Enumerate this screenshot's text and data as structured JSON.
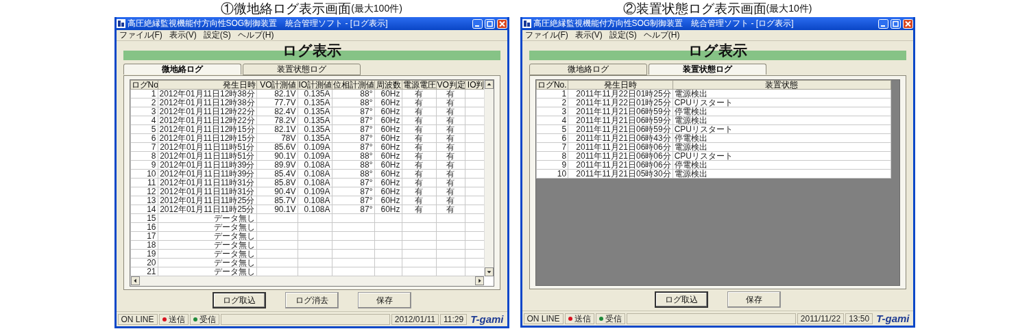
{
  "screens": [
    {
      "caption": "①微地絡ログ表示画面",
      "caption_note": "(最大100件)",
      "window": {
        "title": "高圧絶縁監視機能付方向性SOG制御装置　統合管理ソフト - [ログ表示]",
        "menu": [
          "ファイル(F)",
          "表示(V)",
          "設定(S)",
          "ヘルプ(H)"
        ],
        "heading": "ログ表示",
        "tabs": [
          {
            "label": "微地絡ログ",
            "selected": true
          },
          {
            "label": "装置状態ログ",
            "selected": false
          }
        ],
        "table": {
          "kind": "measurement",
          "columns": [
            "ログNo",
            "発生日時",
            "VO計測値",
            "IO計測値",
            "位相計測値",
            "周波数",
            "電源電圧",
            "VO判定",
            "IO判"
          ],
          "rows": [
            [
              "1",
              "2012年01月11日12時38分",
              "82.1V",
              "0.135A",
              "88°",
              "60Hz",
              "有",
              "有"
            ],
            [
              "2",
              "2012年01月11日12時38分",
              "77.7V",
              "0.135A",
              "88°",
              "60Hz",
              "有",
              "有"
            ],
            [
              "3",
              "2012年01月11日12時22分",
              "82.4V",
              "0.135A",
              "87°",
              "60Hz",
              "有",
              "有"
            ],
            [
              "4",
              "2012年01月11日12時22分",
              "78.2V",
              "0.135A",
              "87°",
              "60Hz",
              "有",
              "有"
            ],
            [
              "5",
              "2012年01月11日12時15分",
              "82.1V",
              "0.135A",
              "87°",
              "60Hz",
              "有",
              "有"
            ],
            [
              "6",
              "2012年01月11日12時15分",
              "78V",
              "0.135A",
              "87°",
              "60Hz",
              "有",
              "有"
            ],
            [
              "7",
              "2012年01月11日11時51分",
              "85.6V",
              "0.109A",
              "87°",
              "60Hz",
              "有",
              "有"
            ],
            [
              "8",
              "2012年01月11日11時51分",
              "90.1V",
              "0.109A",
              "88°",
              "60Hz",
              "有",
              "有"
            ],
            [
              "9",
              "2012年01月11日11時39分",
              "89.9V",
              "0.108A",
              "88°",
              "60Hz",
              "有",
              "有"
            ],
            [
              "10",
              "2012年01月11日11時39分",
              "85.4V",
              "0.108A",
              "88°",
              "60Hz",
              "有",
              "有"
            ],
            [
              "11",
              "2012年01月11日11時31分",
              "85.8V",
              "0.108A",
              "87°",
              "60Hz",
              "有",
              "有"
            ],
            [
              "12",
              "2012年01月11日11時31分",
              "90.4V",
              "0.109A",
              "87°",
              "60Hz",
              "有",
              "有"
            ],
            [
              "13",
              "2012年01月11日11時25分",
              "85.7V",
              "0.108A",
              "87°",
              "60Hz",
              "有",
              "有"
            ],
            [
              "14",
              "2012年01月11日11時25分",
              "90.1V",
              "0.108A",
              "87°",
              "60Hz",
              "有",
              "有"
            ],
            [
              "15",
              "データ無し"
            ],
            [
              "16",
              "データ無し"
            ],
            [
              "17",
              "データ無し"
            ],
            [
              "18",
              "データ無し"
            ],
            [
              "19",
              "データ無し"
            ],
            [
              "20",
              "データ無し"
            ],
            [
              "21",
              "データ無し"
            ]
          ]
        },
        "buttons": [
          {
            "label": "ログ取込",
            "default": true
          },
          {
            "label": "ログ消去",
            "default": false
          },
          {
            "label": "保存",
            "default": false
          }
        ],
        "status_bar": {
          "mode": "ON LINE",
          "indicators": [
            {
              "label": "送信",
              "color": "#d8121f"
            },
            {
              "label": "受信",
              "color": "#1f8a3a"
            }
          ],
          "date": "2012/01/11",
          "time": "11:29",
          "logo": "T-gami"
        }
      }
    },
    {
      "caption": "②装置状態ログ表示画面",
      "caption_note": "(最大10件)",
      "window": {
        "title": "高圧絶縁監視機能付方向性SOG制御装置　統合管理ソフト - [ログ表示]",
        "menu": [
          "ファイル(F)",
          "表示(V)",
          "設定(S)",
          "ヘルプ(H)"
        ],
        "heading": "ログ表示",
        "tabs": [
          {
            "label": "微地絡ログ",
            "selected": false
          },
          {
            "label": "装置状態ログ",
            "selected": true
          }
        ],
        "table": {
          "kind": "status",
          "columns": [
            "ログNo.",
            "発生日時",
            "装置状態"
          ],
          "rows": [
            [
              "1",
              "2011年11月22日01時25分",
              "電源検出"
            ],
            [
              "2",
              "2011年11月22日01時25分",
              "CPUリスタート"
            ],
            [
              "3",
              "2011年11月21日06時59分",
              "停電検出"
            ],
            [
              "4",
              "2011年11月21日06時59分",
              "電源検出"
            ],
            [
              "5",
              "2011年11月21日06時59分",
              "CPUリスタート"
            ],
            [
              "6",
              "2011年11月21日06時43分",
              "停電検出"
            ],
            [
              "7",
              "2011年11月21日06時06分",
              "電源検出"
            ],
            [
              "8",
              "2011年11月21日06時06分",
              "CPUリスタート"
            ],
            [
              "9",
              "2011年11月21日06時06分",
              "停電検出"
            ],
            [
              "10",
              "2011年11月21日05時30分",
              "電源検出"
            ]
          ]
        },
        "buttons": [
          {
            "label": "ログ取込",
            "default": true
          },
          {
            "label": "保存",
            "default": false
          }
        ],
        "status_bar": {
          "mode": "ON LINE",
          "indicators": [
            {
              "label": "送信",
              "color": "#d8121f"
            },
            {
              "label": "受信",
              "color": "#1f8a3a"
            }
          ],
          "date": "2011/11/22",
          "time": "13:50",
          "logo": "T-gami"
        }
      }
    }
  ]
}
